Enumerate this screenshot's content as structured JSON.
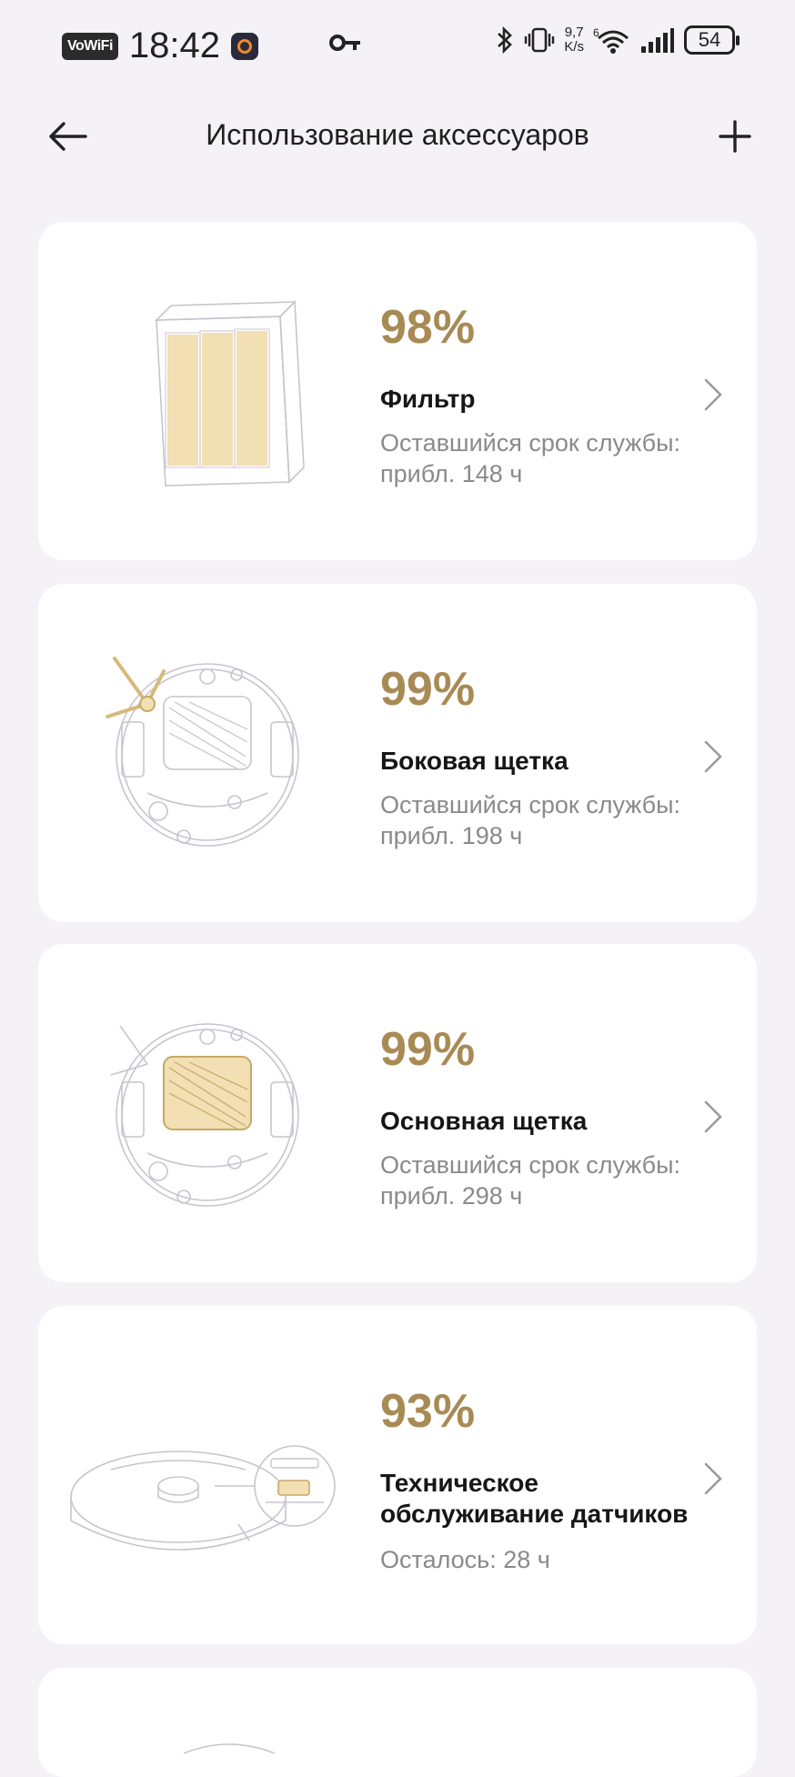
{
  "status_bar": {
    "vowifi": "VoWiFi",
    "time": "18:42",
    "speed_top": "9,7",
    "speed_bottom": "K/s",
    "network": "6",
    "battery": "54"
  },
  "header": {
    "title": "Использование аксессуаров"
  },
  "accessories": [
    {
      "percent": "98%",
      "name": "Фильтр",
      "remaining": "Оставшийся срок службы: прибл. 148 ч",
      "icon": "filter-illustration"
    },
    {
      "percent": "99%",
      "name": "Боковая щетка",
      "remaining": "Оставшийся срок службы: прибл. 198 ч",
      "icon": "side-brush-illustration"
    },
    {
      "percent": "99%",
      "name": "Основная щетка",
      "remaining": "Оставшийся срок службы: прибл. 298 ч",
      "icon": "main-brush-illustration"
    },
    {
      "percent": "93%",
      "name": "Техническое обслуживание датчиков",
      "remaining": "Осталось: 28 ч",
      "icon": "sensor-maintenance-illustration"
    }
  ],
  "colors": {
    "background": "#f4f2f6",
    "card": "#ffffff",
    "accent": "#a88a55",
    "secondary_text": "#8a8a8a"
  }
}
